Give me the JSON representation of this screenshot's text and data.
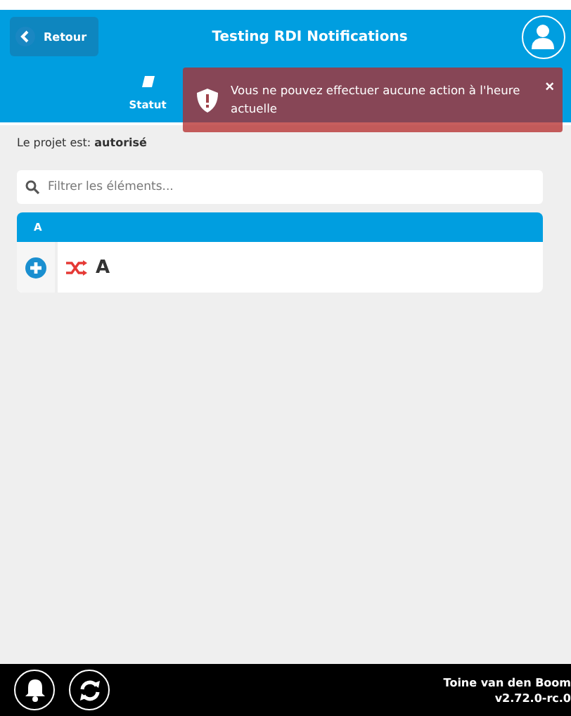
{
  "header": {
    "back_label": "Retour",
    "title": "Testing RDI Notifications"
  },
  "tabs": [
    {
      "label": "Statut",
      "selected": true
    }
  ],
  "toast": {
    "message": "Vous ne pouvez effectuer aucune action à l'heure actuelle",
    "close": "×"
  },
  "project_status": {
    "label": "Le projet est:",
    "value": "autorisé"
  },
  "search": {
    "placeholder": "Filtrer les éléments..."
  },
  "groups": [
    {
      "title": "A",
      "items": [
        {
          "name": "A"
        }
      ]
    }
  ],
  "footer": {
    "user": "Toine van den Boom",
    "version": "v2.72.0-rc.0"
  }
}
